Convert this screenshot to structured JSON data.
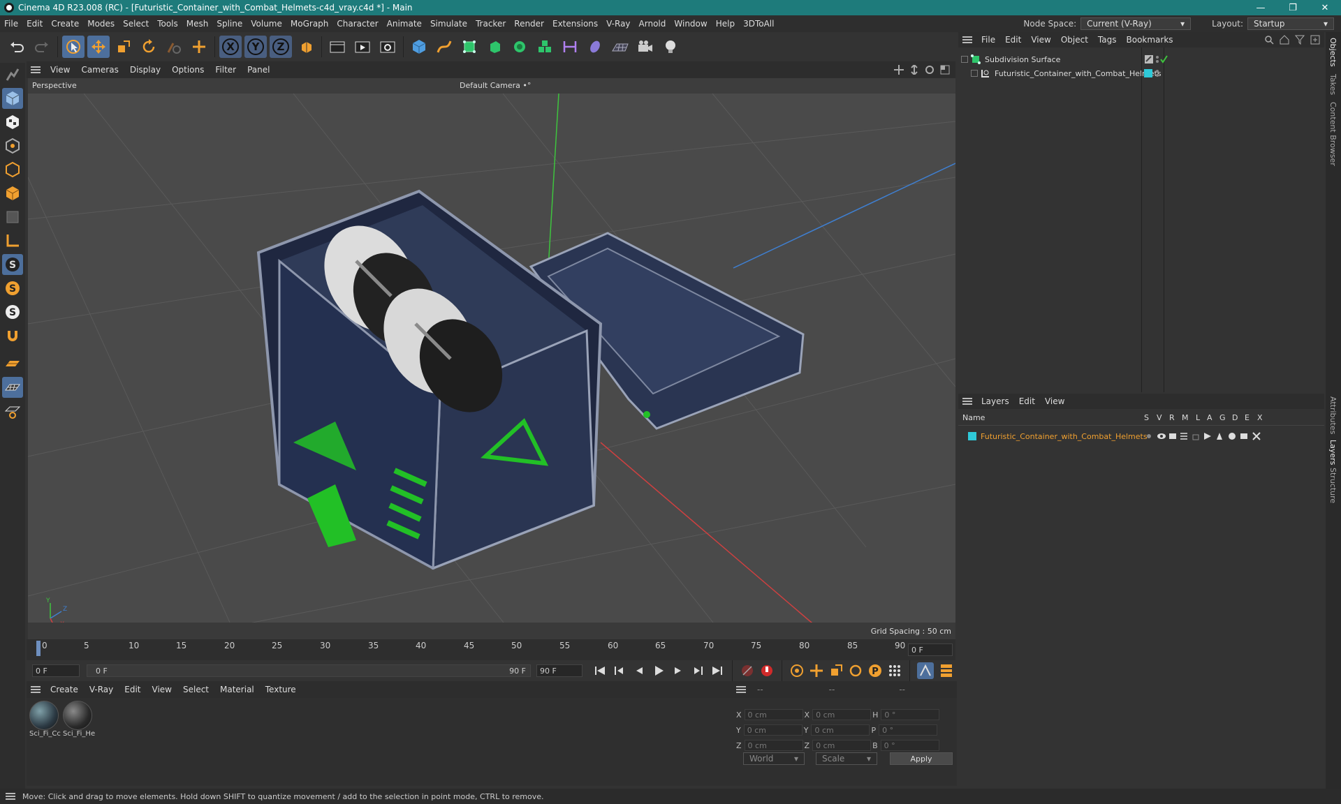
{
  "window": {
    "title": "Cinema 4D R23.008 (RC) - [Futuristic_Container_with_Combat_Helmets-c4d_vray.c4d *] - Main",
    "controls": [
      "—",
      "❐",
      "✕"
    ]
  },
  "menubar": {
    "items": [
      "File",
      "Edit",
      "Create",
      "Modes",
      "Select",
      "Tools",
      "Mesh",
      "Spline",
      "Volume",
      "MoGraph",
      "Character",
      "Animate",
      "Simulate",
      "Tracker",
      "Render",
      "Extensions",
      "V-Ray",
      "Arnold",
      "Window",
      "Help",
      "3DToAll"
    ],
    "node_space_label": "Node Space:",
    "node_space_value": "Current (V-Ray)",
    "layout_label": "Layout:",
    "layout_value": "Startup"
  },
  "toolbar": {
    "axis_x": "X",
    "axis_y": "Y",
    "axis_z": "Z"
  },
  "viewport": {
    "menu": [
      "View",
      "Cameras",
      "Display",
      "Options",
      "Filter",
      "Panel"
    ],
    "view_name": "Perspective",
    "camera": "Default Camera •°",
    "grid_spacing": "Grid Spacing : 50 cm",
    "axis_labels": [
      "Y",
      "Z",
      "X"
    ]
  },
  "timeline": {
    "ticks": [
      "0",
      "5",
      "10",
      "15",
      "20",
      "25",
      "30",
      "35",
      "40",
      "45",
      "50",
      "55",
      "60",
      "65",
      "70",
      "75",
      "80",
      "85",
      "90"
    ],
    "current_frame": "0 F"
  },
  "transport": {
    "start_frame": "0 F",
    "range_start": "0 F",
    "range_end": "90 F",
    "end_frame": "90 F"
  },
  "materials": {
    "menu": [
      "Create",
      "V-Ray",
      "Edit",
      "View",
      "Select",
      "Material",
      "Texture"
    ],
    "items": [
      {
        "label": "Sci_Fi_Cc"
      },
      {
        "label": "Sci_Fi_He"
      }
    ]
  },
  "coordinates": {
    "header": [
      "--",
      "--",
      "--"
    ],
    "rows": [
      {
        "a_label": "X",
        "a_val": "0 cm",
        "b_label": "X",
        "b_val": "0 cm",
        "c_label": "H",
        "c_val": "0 °"
      },
      {
        "a_label": "Y",
        "a_val": "0 cm",
        "b_label": "Y",
        "b_val": "0 cm",
        "c_label": "P",
        "c_val": "0 °"
      },
      {
        "a_label": "Z",
        "a_val": "0 cm",
        "b_label": "Z",
        "b_val": "0 cm",
        "c_label": "B",
        "c_val": "0 °"
      }
    ],
    "space": "World",
    "mode": "Scale",
    "apply": "Apply"
  },
  "objects": {
    "menu": [
      "File",
      "Edit",
      "View",
      "Object",
      "Tags",
      "Bookmarks"
    ],
    "items": [
      {
        "name": "Subdivision Surface"
      },
      {
        "name": "Futuristic_Container_with_Combat_Helmets"
      }
    ]
  },
  "layers": {
    "menu": [
      "Layers",
      "Edit",
      "View"
    ],
    "columns": [
      "Name",
      "S",
      "V",
      "R",
      "M",
      "L",
      "A",
      "G",
      "D",
      "E",
      "X"
    ],
    "rows": [
      {
        "name": "Futuristic_Container_with_Combat_Helmets",
        "color": "#2fc9d8"
      }
    ]
  },
  "sidetabs": [
    "Objects",
    "Takes",
    "Content Browser",
    "Attributes",
    "Layers",
    "Structure"
  ],
  "status": "Move: Click and drag to move elements. Hold down SHIFT to quantize movement / add to the selection in point mode, CTRL to remove.",
  "colors": {
    "titlebar": "#1e7b7b",
    "accent_orange": "#f0a030",
    "selection_blue": "#4d6f9c",
    "crate_green": "#22c026",
    "crate_navy": "#2a3552"
  }
}
